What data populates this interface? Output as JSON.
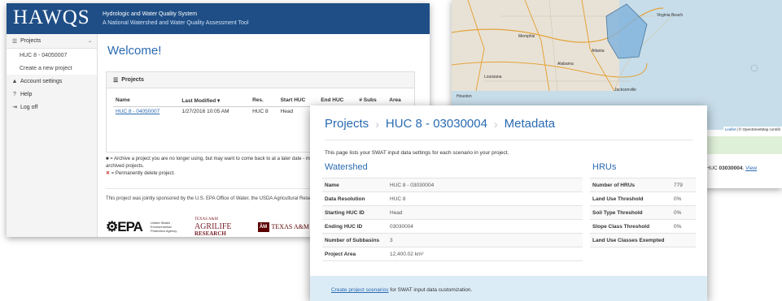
{
  "left_window": {
    "brand": "HAWQS",
    "tagline1": "Hydrologic and Water Quality System",
    "tagline2": "A National Watershed and Water Quality Assessment Tool",
    "sidebar": {
      "projects_label": "Projects",
      "project_item": "HUC 8 - 04050007",
      "create_item": "Create a new project",
      "account_label": "Account settings",
      "help_label": "Help",
      "logoff_label": "Log off"
    },
    "welcome": "Welcome!",
    "panel_title": "Projects",
    "table": {
      "headers": [
        "Name",
        "Last Modified ▾",
        "Res.",
        "Start HUC",
        "End HUC",
        "# Subs",
        "Area"
      ],
      "rows": [
        [
          "HUC 8 - 04050007",
          "1/27/2016 10:05 AM",
          "HUC 8",
          "Head",
          "04050007",
          "1",
          ""
        ]
      ]
    },
    "legend_archive": "= Archive a project you are no longer using, but may want to come back to at a later date - m",
    "legend_archive_cont": "archived projects.",
    "legend_delete": "= Permanently delete project.",
    "sponsor_text": "This project was jointly sponsored by the U.S. EPA Office of Water, the USDA Agricultural Resea",
    "logos": {
      "epa": "EPA",
      "epa_sub": "United States Environmental Protection Agency",
      "agrilife_top": "TEXAS A&M",
      "agrilife_mid": "AGRILIFE",
      "agrilife_bottom": "RESEARCH",
      "tamu": "TEXAS A&M"
    }
  },
  "right_window": {
    "cities": [
      "Memphis",
      "Atlanta",
      "Jacksonville",
      "Houston",
      "Louisiana",
      "Alabama",
      "Virginia Beach"
    ],
    "attribution_leaflet": "Leaflet",
    "attribution_osm": "© OpenStreetMap contrib",
    "text_prefix": "d to HUC",
    "text_huc": "03030004",
    "text_link": "View"
  },
  "front_window": {
    "breadcrumb": [
      "Projects",
      "HUC 8 - 03030004",
      "Metadata"
    ],
    "intro": "This page lists your SWAT input data settings for each scenario in your project.",
    "watershed_title": "Watershed",
    "watershed": [
      {
        "k": "Name",
        "v": "HUC 8 - 03030004"
      },
      {
        "k": "Data Resolution",
        "v": "HUC 8"
      },
      {
        "k": "Starting HUC ID",
        "v": "Head"
      },
      {
        "k": "Ending HUC ID",
        "v": "03030004"
      },
      {
        "k": "Number of Subbasins",
        "v": "3"
      },
      {
        "k": "Project Area",
        "v": "12,400.02 km²"
      }
    ],
    "hrus_title": "HRUs",
    "hrus": [
      {
        "k": "Number of HRUs",
        "v": "779"
      },
      {
        "k": "Land Use Threshold",
        "v": "0%"
      },
      {
        "k": "Soil Type Threshold",
        "v": "0%"
      },
      {
        "k": "Slope Class Threshold",
        "v": "0%"
      },
      {
        "k": "Land Use Classes Exempted",
        "v": ""
      }
    ],
    "cta_link": "Create project scenarios",
    "cta_rest": " for SWAT input data customization."
  }
}
